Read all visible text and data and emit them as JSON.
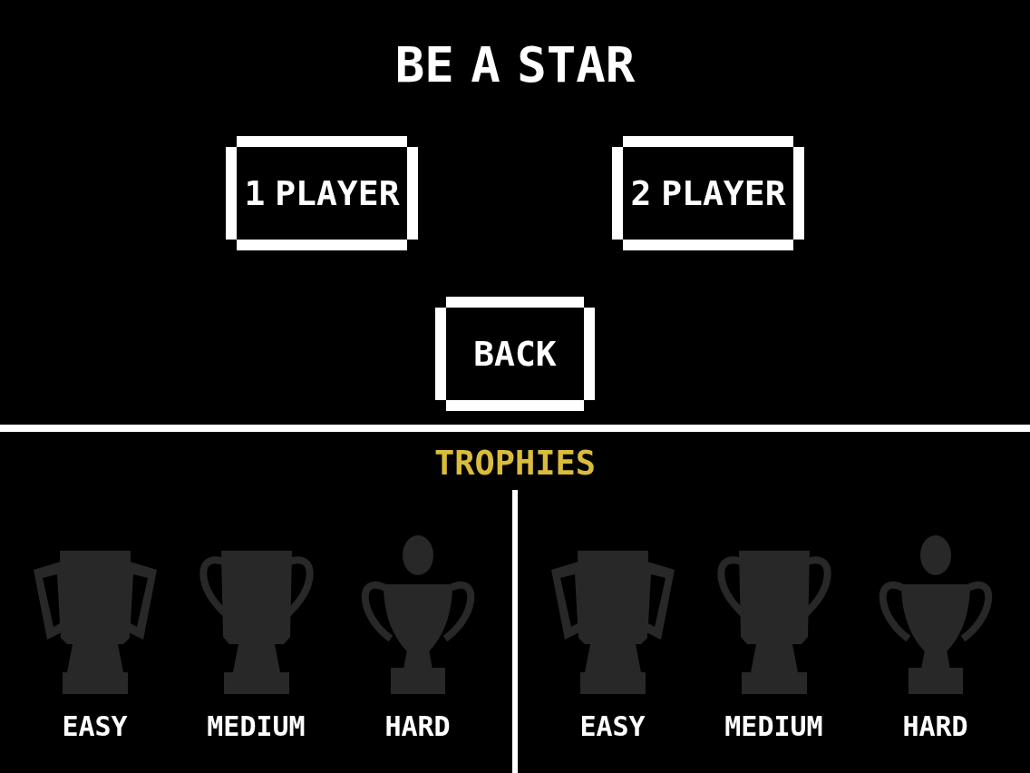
{
  "title": "BE A STAR",
  "mode_buttons": [
    {
      "label": "1 PLAYER"
    },
    {
      "label": "2 PLAYER"
    }
  ],
  "back_button": {
    "label": "BACK"
  },
  "trophies": {
    "title": "TROPHIES",
    "panels": [
      {
        "items": [
          {
            "kind": "easy",
            "label": "EASY",
            "earned": false
          },
          {
            "kind": "medium",
            "label": "MEDIUM",
            "earned": false
          },
          {
            "kind": "hard",
            "label": "HARD",
            "earned": false
          }
        ]
      },
      {
        "items": [
          {
            "kind": "easy",
            "label": "EASY",
            "earned": false
          },
          {
            "kind": "medium",
            "label": "MEDIUM",
            "earned": false
          },
          {
            "kind": "hard",
            "label": "HARD",
            "earned": false
          }
        ]
      }
    ]
  }
}
